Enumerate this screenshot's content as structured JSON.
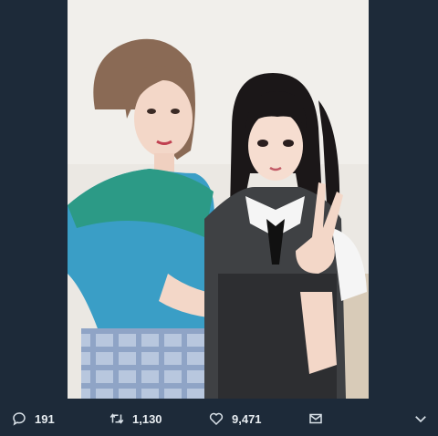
{
  "tweet": {
    "photo": {
      "description_icon": "photo"
    },
    "actions": {
      "reply_count": "191",
      "retweet_count": "1,130",
      "like_count": "9,471"
    },
    "icons": {
      "reply": "reply-icon",
      "retweet": "retweet-icon",
      "like": "heart-icon",
      "message": "mail-icon",
      "more": "chevron-down-icon"
    }
  }
}
